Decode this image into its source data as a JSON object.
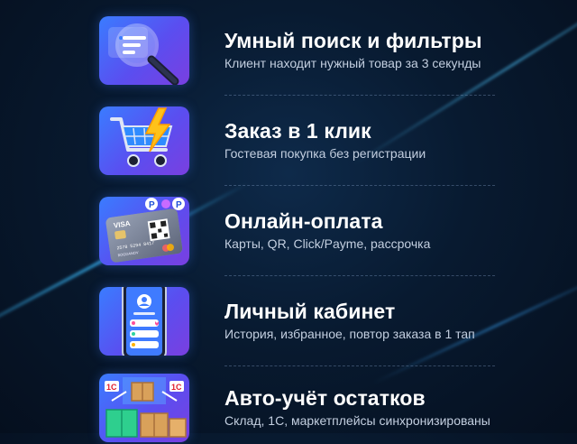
{
  "features": [
    {
      "icon": "magnifier-search-icon",
      "title": "Умный поиск и фильтры",
      "subtitle": "Клиент находит нужный товар за 3 секунды"
    },
    {
      "icon": "shopping-cart-lightning-icon",
      "title": "Заказ в 1 клик",
      "subtitle": "Гостевая покупка без регистрации"
    },
    {
      "icon": "credit-card-payment-icon",
      "title": "Онлайн-оплата",
      "subtitle": "Карты, QR, Click/Payme, рассрочка",
      "card_text": {
        "brand": "VISA",
        "number": "2578 5294 8417",
        "holder": "BOGDANOV"
      }
    },
    {
      "icon": "smartphone-profile-icon",
      "title": "Личный кабинет",
      "subtitle": "История, избранное, повтор заказа в 1 тап"
    },
    {
      "icon": "warehouse-boxes-icon",
      "title": "Авто-учёт остатков",
      "subtitle": "Склад, 1С, маркетплейсы синхронизированы",
      "badge_text": "1С"
    }
  ],
  "colors": {
    "background": "#081a30",
    "title": "#ffffff",
    "subtitle": "#c3cfe0",
    "icon_gradient_start": "#3a7cff",
    "icon_gradient_end": "#7a3fe0",
    "accent_yellow": "#ffc21a"
  }
}
